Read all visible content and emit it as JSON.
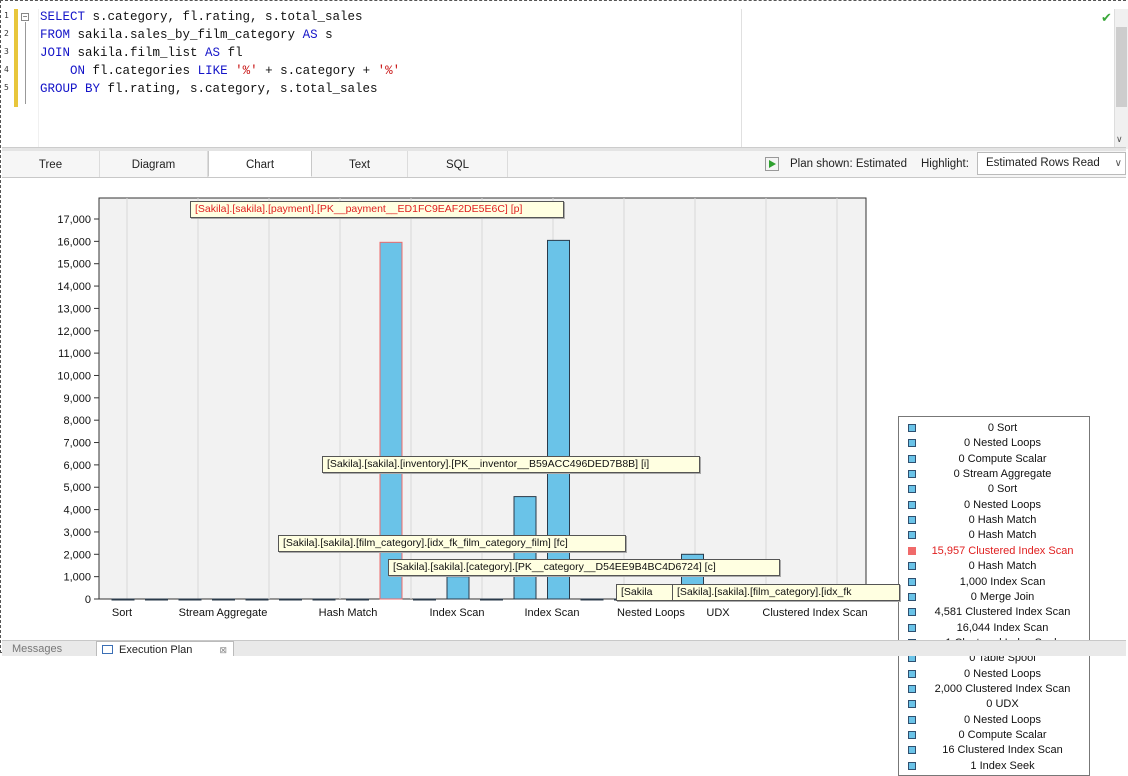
{
  "editor": {
    "line_numbers": [
      "1",
      "2",
      "3",
      "4",
      "5"
    ],
    "lines": [
      [
        {
          "t": "kw",
          "v": "SELECT"
        },
        {
          "t": "",
          "v": " s.category, fl.rating, s.total_sales"
        }
      ],
      [
        {
          "t": "kw",
          "v": "FROM"
        },
        {
          "t": "",
          "v": " sakila.sales_by_film_category "
        },
        {
          "t": "kw",
          "v": "AS"
        },
        {
          "t": "",
          "v": " s"
        }
      ],
      [
        {
          "t": "kw",
          "v": "JOIN"
        },
        {
          "t": "",
          "v": " sakila.film_list "
        },
        {
          "t": "kw",
          "v": "AS"
        },
        {
          "t": "",
          "v": " fl"
        }
      ],
      [
        {
          "t": "",
          "v": "    "
        },
        {
          "t": "kw",
          "v": "ON"
        },
        {
          "t": "",
          "v": " fl.categories "
        },
        {
          "t": "kw",
          "v": "LIKE"
        },
        {
          "t": "",
          "v": " "
        },
        {
          "t": "str",
          "v": "'%'"
        },
        {
          "t": "",
          "v": " + s.category + "
        },
        {
          "t": "str",
          "v": "'%'"
        }
      ],
      [
        {
          "t": "kw",
          "v": "GROUP BY"
        },
        {
          "t": "",
          "v": " fl.rating, s.category, s.total_sales"
        }
      ]
    ]
  },
  "tabs": [
    {
      "label": "Tree",
      "active": false
    },
    {
      "label": "Diagram",
      "active": false
    },
    {
      "label": "Chart",
      "active": true
    },
    {
      "label": "Text",
      "active": false
    },
    {
      "label": "SQL",
      "active": false
    }
  ],
  "toolbar": {
    "plan_shown": "Plan shown: Estimated",
    "highlight_label": "Highlight:",
    "highlight_value": "Estimated Rows Read"
  },
  "colors": {
    "bar": "#6ac3e8",
    "bar_highlight": "#f06a6a",
    "legend_red": "#e02020"
  },
  "chart_data": {
    "type": "bar",
    "ylim": [
      0,
      17000
    ],
    "yticks": [
      "0",
      "1,000",
      "2,000",
      "3,000",
      "4,000",
      "5,000",
      "6,000",
      "7,000",
      "8,000",
      "9,000",
      "10,000",
      "11,000",
      "12,000",
      "13,000",
      "14,000",
      "15,000",
      "16,000",
      "17,000"
    ],
    "x_tick_labels": [
      "Sort",
      "Stream Aggregate",
      "Hash Match",
      "Index Scan",
      "Index Scan",
      "Nested Loops",
      "UDX",
      "Clustered Index Scan"
    ],
    "series": [
      {
        "name": "Sort",
        "value": 0
      },
      {
        "name": "Nested Loops",
        "value": 0
      },
      {
        "name": "Compute Scalar",
        "value": 0
      },
      {
        "name": "Stream Aggregate",
        "value": 0
      },
      {
        "name": "Sort",
        "value": 0
      },
      {
        "name": "Nested Loops",
        "value": 0
      },
      {
        "name": "Hash Match",
        "value": 0
      },
      {
        "name": "Hash Match",
        "value": 0
      },
      {
        "name": "Clustered Index Scan",
        "value": 15957,
        "highlight": true
      },
      {
        "name": "Hash Match",
        "value": 0
      },
      {
        "name": "Index Scan",
        "value": 1000
      },
      {
        "name": "Merge Join",
        "value": 0
      },
      {
        "name": "Clustered Index Scan",
        "value": 4581
      },
      {
        "name": "Index Scan",
        "value": 16044
      },
      {
        "name": "Clustered Index Seek",
        "value": 1
      },
      {
        "name": "Table Spool",
        "value": 0
      },
      {
        "name": "Nested Loops",
        "value": 0
      },
      {
        "name": "Clustered Index Scan",
        "value": 2000
      },
      {
        "name": "UDX",
        "value": 0
      },
      {
        "name": "Nested Loops",
        "value": 0
      },
      {
        "name": "Compute Scalar",
        "value": 0
      },
      {
        "name": "Clustered Index Scan",
        "value": 16
      },
      {
        "name": "Index Seek",
        "value": 1
      }
    ],
    "legend": [
      "0 Sort",
      "0 Nested Loops",
      "0 Compute Scalar",
      "0 Stream Aggregate",
      "0 Sort",
      "0 Nested Loops",
      "0 Hash Match",
      "0 Hash Match",
      "15,957 Clustered Index Scan",
      "0 Hash Match",
      "1,000 Index Scan",
      "0 Merge Join",
      "4,581 Clustered Index Scan",
      "16,044 Index Scan",
      "1 Clustered Index Seek",
      "0 Table Spool",
      "0 Nested Loops",
      "2,000 Clustered Index Scan",
      "0 UDX",
      "0 Nested Loops",
      "0 Compute Scalar",
      "16 Clustered Index Scan",
      "1 Index Seek"
    ],
    "legend_highlight_index": 8,
    "annotations": [
      "[Sakila].[sakila].[payment].[PK__payment__ED1FC9EAF2DE5E6C] [p]",
      "[Sakila].[sakila].[inventory].[PK__inventor__B59ACC496DED7B8B] [i]",
      "[Sakila].[sakila].[film_category].[idx_fk_film_category_film] [fc]",
      "[Sakila].[sakila].[category].[PK__category__D54EE9B4BC4D6724] [c]",
      "[Sakila].[sakila].[film_category].[idx_fk",
      "[Sakila"
    ]
  },
  "bottom": {
    "messages": "Messages",
    "plan": "Execution Plan",
    "close": "⊠"
  }
}
